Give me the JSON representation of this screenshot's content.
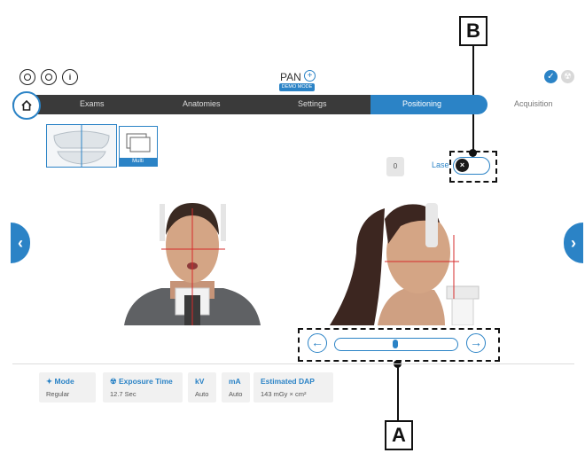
{
  "header": {
    "mode_title": "PAN",
    "demo_badge": "DEMO MODE",
    "icons": [
      "eye-icon",
      "settings-icon",
      "info-icon"
    ],
    "right_icons": [
      "check-icon",
      "radiation-icon"
    ]
  },
  "nav": {
    "tabs": [
      {
        "label": "Exams",
        "state": "done"
      },
      {
        "label": "Anatomies",
        "state": "done"
      },
      {
        "label": "Settings",
        "state": "done"
      },
      {
        "label": "Positioning",
        "state": "active"
      },
      {
        "label": "Acquisition",
        "state": "pending"
      }
    ]
  },
  "thumbs": {
    "multi_label": "Multi"
  },
  "controls": {
    "small_button": "0",
    "laser_label": "Lase",
    "laser_toggle_icon": "close-icon"
  },
  "slider": {
    "position": 0.5
  },
  "info": [
    {
      "title": "Mode",
      "icon": "diamond-icon",
      "value": "Regular"
    },
    {
      "title": "Exposure Time",
      "icon": "radiation-icon",
      "value": "12.7 Sec"
    },
    {
      "title": "kV",
      "value": "Auto"
    },
    {
      "title": "mA",
      "value": "Auto"
    },
    {
      "title": "Estimated DAP",
      "value": "143 mGy × cm²"
    }
  ],
  "callouts": {
    "a": "A",
    "b": "B"
  },
  "colors": {
    "accent": "#2b83c6",
    "nav_dark": "#3a3a3a"
  }
}
